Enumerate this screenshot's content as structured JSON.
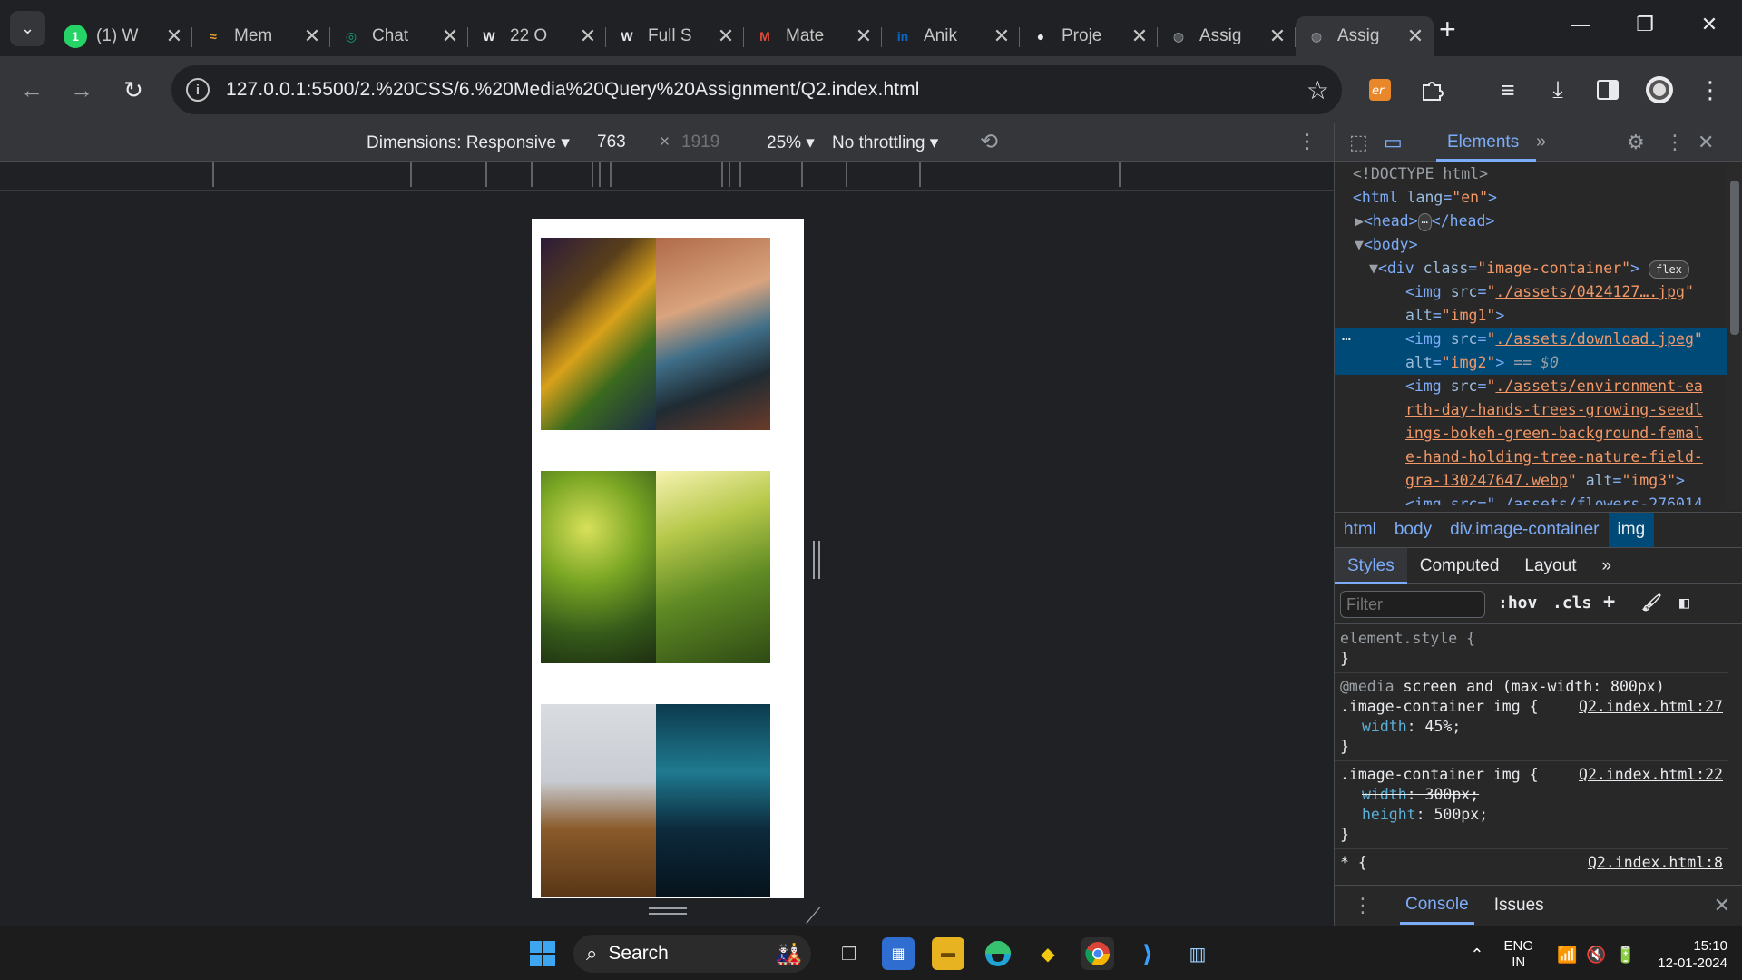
{
  "tabs": [
    {
      "title": "(1) W",
      "favicon": "whatsapp-icon",
      "color": "#25d366",
      "glyph": "1"
    },
    {
      "title": "Mem",
      "favicon": "memes-icon",
      "color": "#e8a030",
      "glyph": "≈"
    },
    {
      "title": "Chat",
      "favicon": "chatgpt-icon",
      "color": "#10a37f",
      "glyph": "◎"
    },
    {
      "title": "22 O",
      "favicon": "wordpress-icon",
      "color": "#e8eaed",
      "glyph": "W"
    },
    {
      "title": "Full S",
      "favicon": "wordpress-icon",
      "color": "#e8eaed",
      "glyph": "W"
    },
    {
      "title": "Mate",
      "favicon": "material-icon",
      "color": "#e24a3b",
      "glyph": "M"
    },
    {
      "title": "Anik",
      "favicon": "linkedin-icon",
      "color": "#0a66c2",
      "glyph": "in"
    },
    {
      "title": "Proje",
      "favicon": "github-icon",
      "color": "#e8eaed",
      "glyph": "●"
    },
    {
      "title": "Assig",
      "favicon": "globe-icon",
      "color": "#9aa0a6",
      "glyph": "◍"
    },
    {
      "title": "Assig",
      "favicon": "globe-icon",
      "color": "#9aa0a6",
      "glyph": "◍",
      "active": true
    }
  ],
  "omnibox": {
    "url": "127.0.0.1:5500/2.%20CSS/6.%20Media%20Query%20Assignment/Q2.index.html"
  },
  "device_toolbar": {
    "dimensions_label": "Dimensions: Responsive",
    "width": "763",
    "times": "×",
    "height_placeholder": "1919",
    "zoom": "25%",
    "throttling": "No throttling"
  },
  "devtools": {
    "elements_tab": "Elements",
    "more_tabs": "»",
    "dom": {
      "doctype": "<!DOCTYPE html>",
      "html_open_tag": "<html",
      "html_attr_name": "lang",
      "html_attr_val": "\"en\"",
      "head": "<head>",
      "head_close": "</head>",
      "body": "<body>",
      "div_open": "<div",
      "div_attr_name": "class",
      "div_attr_val": "\"image-container\"",
      "flex_badge": "flex",
      "img1_src": "./assets/0424127….jpg",
      "img1_alt": "\"img1\"",
      "img2_src": "./assets/download.jpeg",
      "img2_alt": "\"img2\"",
      "img2_eq": "== $0",
      "img3_src_1": "./assets/environment-ea",
      "img3_src_2": "rth-day-hands-trees-growing-seedl",
      "img3_src_3": "ings-bokeh-green-background-femal",
      "img3_src_4": "e-hand-holding-tree-nature-field-",
      "img3_src_5": "gra-130247647.webp",
      "img3_alt": "\"img3\"",
      "img4_partial": "<img src=\"./assets/flowers-276014"
    },
    "breadcrumbs": [
      "html",
      "body",
      "div.image-container",
      "img"
    ],
    "styles_tabs": [
      "Styles",
      "Computed",
      "Layout"
    ],
    "filter_placeholder": "Filter",
    "hov": ":hov",
    "cls": ".cls",
    "rules": {
      "element_style": "element.style {",
      "close": "}",
      "media_at": "@media",
      "media_query": "screen and (max-width: 800px)",
      "r1_selector": ".image-container img {",
      "r1_source": "Q2.index.html:27",
      "r1_prop": "width",
      "r1_val": "45%;",
      "r2_selector": ".image-container img {",
      "r2_source": "Q2.index.html:22",
      "r2_prop1": "width",
      "r2_val1": "300px;",
      "r2_prop2": "height",
      "r2_val2": "500px;",
      "r3_selector": "* {",
      "r3_source": "Q2.index.html:8"
    },
    "drawer": {
      "console": "Console",
      "issues": "Issues"
    }
  },
  "taskbar": {
    "search": "Search",
    "lang1": "ENG",
    "lang2": "IN",
    "time": "15:10",
    "date": "12-01-2024"
  },
  "images": [
    {
      "name": "autumn-leaves-image",
      "gradient": "linear-gradient(135deg,#2b1a3a 0%,#5a3f1a 30%,#d8a11a 50%,#3b6a1d 70%,#1c2a48 100%)"
    },
    {
      "name": "laptop-hands-image",
      "gradient": "linear-gradient(160deg,#b06a4a 0%,#d9a47e 35%,#3f6e88 55%,#1f2b33 75%,#6b3b2a 100%)"
    },
    {
      "name": "earth-tree-hands-image",
      "gradient": "radial-gradient(circle at 40% 30%,#d8e05a 0%,#7aa624 35%,#355a1a 70%,#1d2e10 100%)"
    },
    {
      "name": "sunlit-grass-image",
      "gradient": "linear-gradient(160deg,#f6f2b0 0%,#b6c84a 30%,#5f8a24 60%,#2e4a14 100%)"
    },
    {
      "name": "hooded-person-image",
      "gradient": "linear-gradient(180deg,#d9dde2 0%,#c8ccd2 40%,#8a5a2a 65%,#5a3717 100%)"
    },
    {
      "name": "aurora-cave-image",
      "gradient": "linear-gradient(180deg,#0c3a4e 0%,#1f7a90 35%,#0d2a3c 65%,#05131c 100%)"
    }
  ]
}
